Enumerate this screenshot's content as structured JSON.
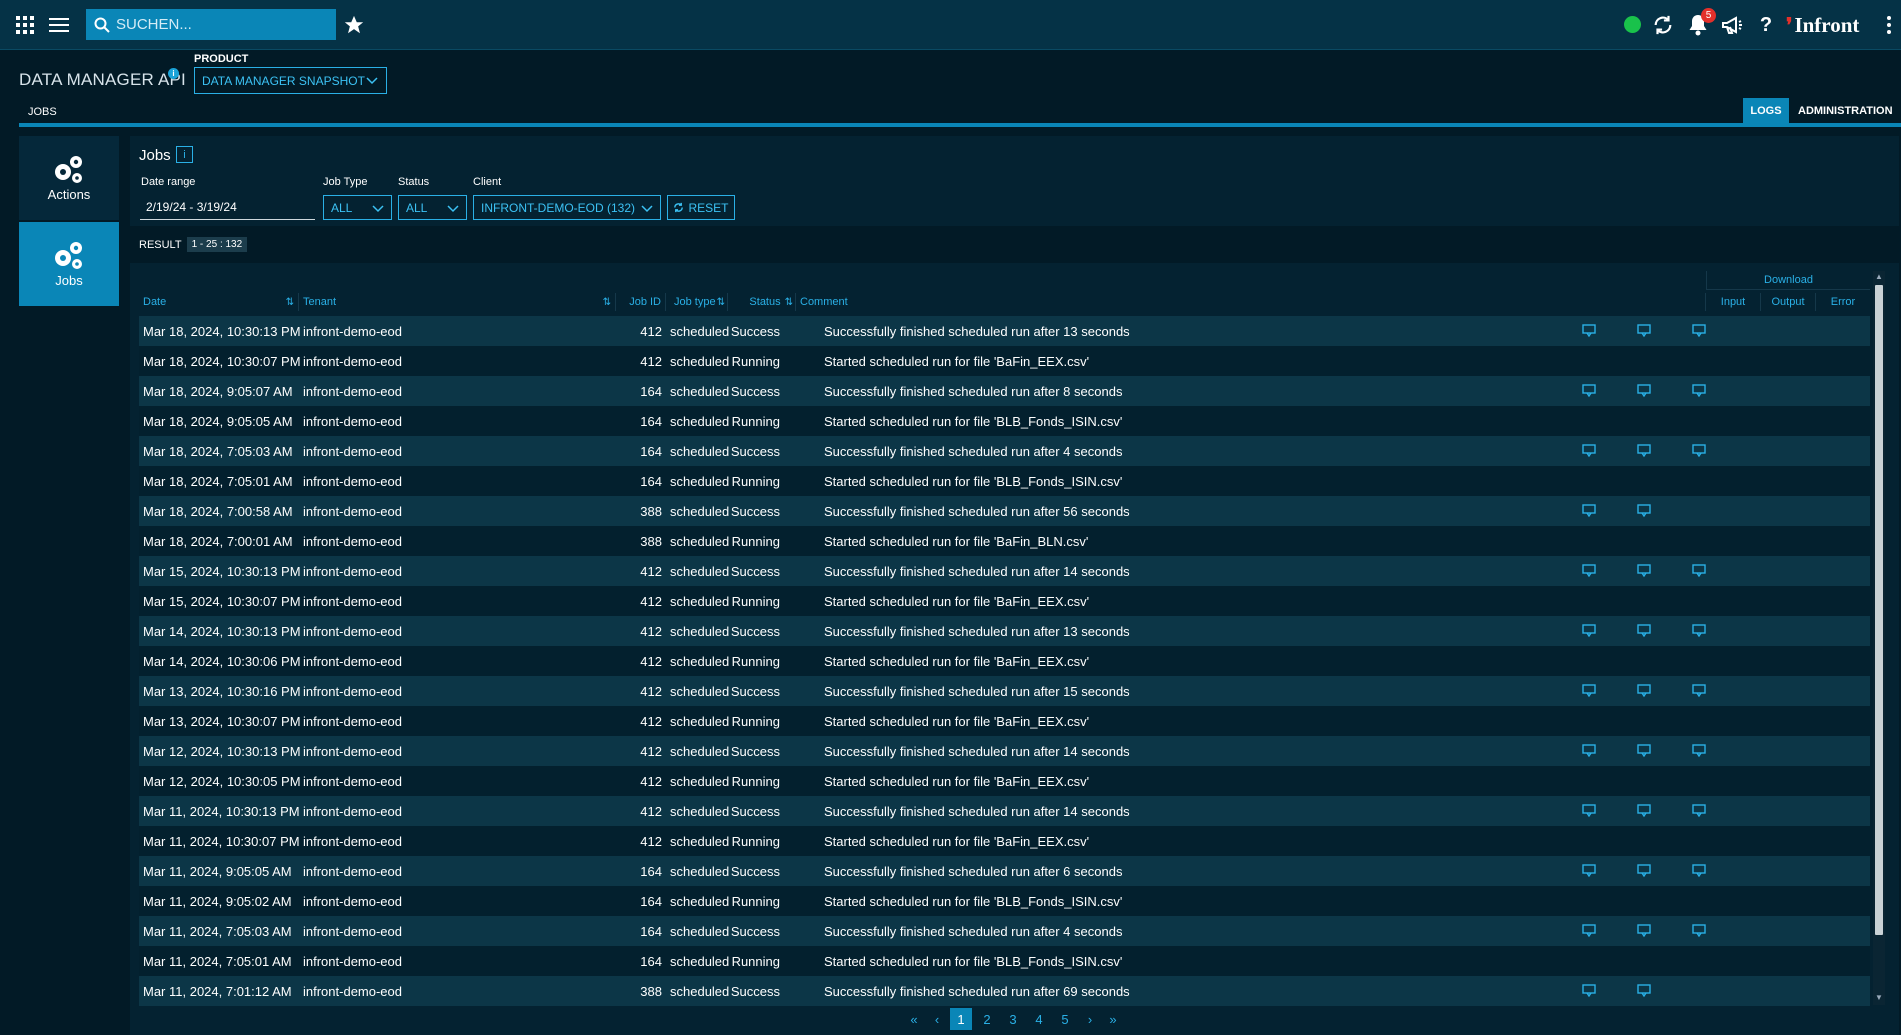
{
  "topbar": {
    "search_placeholder": "SUCHEN...",
    "notification_count": "5",
    "brand": "Infront",
    "status_color": "#19c24b"
  },
  "header": {
    "app_title": "DATA MANAGER API",
    "product_label": "PRODUCT",
    "product_value": "DATA MANAGER SNAPSHOT",
    "tabs": {
      "left": "JOBS",
      "logs": "LOGS",
      "admin": "ADMINISTRATION"
    }
  },
  "nav": [
    {
      "label": "Actions",
      "icon": "gears-icon"
    },
    {
      "label": "Jobs",
      "icon": "gears-icon"
    }
  ],
  "filters": {
    "title": "Jobs",
    "info": "i",
    "date_label": "Date range",
    "date_value": "2/19/24 - 3/19/24",
    "jobtype_label": "Job Type",
    "jobtype_value": "ALL",
    "status_label": "Status",
    "status_value": "ALL",
    "client_label": "Client",
    "client_value": "INFRONT-DEMO-EOD (132)",
    "reset_label": "RESET"
  },
  "result": {
    "label": "RESULT",
    "range": "1 - 25 : 132"
  },
  "table": {
    "download_header": "Download",
    "columns": [
      "Date",
      "Tenant",
      "Job ID",
      "Job type",
      "Status",
      "Comment",
      "Input",
      "Output",
      "Error"
    ],
    "rows": [
      {
        "date": "Mar 18, 2024, 10:30:13 PM",
        "tenant": "infront-demo-eod",
        "id": "412",
        "type": "scheduled",
        "status": "Success",
        "comment": "Successfully finished scheduled run after 13 seconds",
        "dl": [
          1,
          1,
          1
        ]
      },
      {
        "date": "Mar 18, 2024, 10:30:07 PM",
        "tenant": "infront-demo-eod",
        "id": "412",
        "type": "scheduled",
        "status": "Running",
        "comment": "Started scheduled run for file 'BaFin_EEX.csv'",
        "dl": [
          0,
          0,
          0
        ]
      },
      {
        "date": "Mar 18, 2024, 9:05:07 AM",
        "tenant": "infront-demo-eod",
        "id": "164",
        "type": "scheduled",
        "status": "Success",
        "comment": "Successfully finished scheduled run after 8 seconds",
        "dl": [
          1,
          1,
          1
        ]
      },
      {
        "date": "Mar 18, 2024, 9:05:05 AM",
        "tenant": "infront-demo-eod",
        "id": "164",
        "type": "scheduled",
        "status": "Running",
        "comment": "Started scheduled run for file 'BLB_Fonds_ISIN.csv'",
        "dl": [
          0,
          0,
          0
        ]
      },
      {
        "date": "Mar 18, 2024, 7:05:03 AM",
        "tenant": "infront-demo-eod",
        "id": "164",
        "type": "scheduled",
        "status": "Success",
        "comment": "Successfully finished scheduled run after 4 seconds",
        "dl": [
          1,
          1,
          1
        ]
      },
      {
        "date": "Mar 18, 2024, 7:05:01 AM",
        "tenant": "infront-demo-eod",
        "id": "164",
        "type": "scheduled",
        "status": "Running",
        "comment": "Started scheduled run for file 'BLB_Fonds_ISIN.csv'",
        "dl": [
          0,
          0,
          0
        ]
      },
      {
        "date": "Mar 18, 2024, 7:00:58 AM",
        "tenant": "infront-demo-eod",
        "id": "388",
        "type": "scheduled",
        "status": "Success",
        "comment": "Successfully finished scheduled run after 56 seconds",
        "dl": [
          1,
          1,
          0
        ]
      },
      {
        "date": "Mar 18, 2024, 7:00:01 AM",
        "tenant": "infront-demo-eod",
        "id": "388",
        "type": "scheduled",
        "status": "Running",
        "comment": "Started scheduled run for file 'BaFin_BLN.csv'",
        "dl": [
          0,
          0,
          0
        ]
      },
      {
        "date": "Mar 15, 2024, 10:30:13 PM",
        "tenant": "infront-demo-eod",
        "id": "412",
        "type": "scheduled",
        "status": "Success",
        "comment": "Successfully finished scheduled run after 14 seconds",
        "dl": [
          1,
          1,
          1
        ]
      },
      {
        "date": "Mar 15, 2024, 10:30:07 PM",
        "tenant": "infront-demo-eod",
        "id": "412",
        "type": "scheduled",
        "status": "Running",
        "comment": "Started scheduled run for file 'BaFin_EEX.csv'",
        "dl": [
          0,
          0,
          0
        ]
      },
      {
        "date": "Mar 14, 2024, 10:30:13 PM",
        "tenant": "infront-demo-eod",
        "id": "412",
        "type": "scheduled",
        "status": "Success",
        "comment": "Successfully finished scheduled run after 13 seconds",
        "dl": [
          1,
          1,
          1
        ]
      },
      {
        "date": "Mar 14, 2024, 10:30:06 PM",
        "tenant": "infront-demo-eod",
        "id": "412",
        "type": "scheduled",
        "status": "Running",
        "comment": "Started scheduled run for file 'BaFin_EEX.csv'",
        "dl": [
          0,
          0,
          0
        ]
      },
      {
        "date": "Mar 13, 2024, 10:30:16 PM",
        "tenant": "infront-demo-eod",
        "id": "412",
        "type": "scheduled",
        "status": "Success",
        "comment": "Successfully finished scheduled run after 15 seconds",
        "dl": [
          1,
          1,
          1
        ]
      },
      {
        "date": "Mar 13, 2024, 10:30:07 PM",
        "tenant": "infront-demo-eod",
        "id": "412",
        "type": "scheduled",
        "status": "Running",
        "comment": "Started scheduled run for file 'BaFin_EEX.csv'",
        "dl": [
          0,
          0,
          0
        ]
      },
      {
        "date": "Mar 12, 2024, 10:30:13 PM",
        "tenant": "infront-demo-eod",
        "id": "412",
        "type": "scheduled",
        "status": "Success",
        "comment": "Successfully finished scheduled run after 14 seconds",
        "dl": [
          1,
          1,
          1
        ]
      },
      {
        "date": "Mar 12, 2024, 10:30:05 PM",
        "tenant": "infront-demo-eod",
        "id": "412",
        "type": "scheduled",
        "status": "Running",
        "comment": "Started scheduled run for file 'BaFin_EEX.csv'",
        "dl": [
          0,
          0,
          0
        ]
      },
      {
        "date": "Mar 11, 2024, 10:30:13 PM",
        "tenant": "infront-demo-eod",
        "id": "412",
        "type": "scheduled",
        "status": "Success",
        "comment": "Successfully finished scheduled run after 14 seconds",
        "dl": [
          1,
          1,
          1
        ]
      },
      {
        "date": "Mar 11, 2024, 10:30:07 PM",
        "tenant": "infront-demo-eod",
        "id": "412",
        "type": "scheduled",
        "status": "Running",
        "comment": "Started scheduled run for file 'BaFin_EEX.csv'",
        "dl": [
          0,
          0,
          0
        ]
      },
      {
        "date": "Mar 11, 2024, 9:05:05 AM",
        "tenant": "infront-demo-eod",
        "id": "164",
        "type": "scheduled",
        "status": "Success",
        "comment": "Successfully finished scheduled run after 6 seconds",
        "dl": [
          1,
          1,
          1
        ]
      },
      {
        "date": "Mar 11, 2024, 9:05:02 AM",
        "tenant": "infront-demo-eod",
        "id": "164",
        "type": "scheduled",
        "status": "Running",
        "comment": "Started scheduled run for file 'BLB_Fonds_ISIN.csv'",
        "dl": [
          0,
          0,
          0
        ]
      },
      {
        "date": "Mar 11, 2024, 7:05:03 AM",
        "tenant": "infront-demo-eod",
        "id": "164",
        "type": "scheduled",
        "status": "Success",
        "comment": "Successfully finished scheduled run after 4 seconds",
        "dl": [
          1,
          1,
          1
        ]
      },
      {
        "date": "Mar 11, 2024, 7:05:01 AM",
        "tenant": "infront-demo-eod",
        "id": "164",
        "type": "scheduled",
        "status": "Running",
        "comment": "Started scheduled run for file 'BLB_Fonds_ISIN.csv'",
        "dl": [
          0,
          0,
          0
        ]
      },
      {
        "date": "Mar 11, 2024, 7:01:12 AM",
        "tenant": "infront-demo-eod",
        "id": "388",
        "type": "scheduled",
        "status": "Success",
        "comment": "Successfully finished scheduled run after 69 seconds",
        "dl": [
          1,
          1,
          0
        ]
      }
    ]
  },
  "pagination": {
    "first": "«",
    "prev": "‹",
    "pages": [
      "1",
      "2",
      "3",
      "4",
      "5"
    ],
    "current": "1",
    "next": "›",
    "last": "»"
  },
  "colors": {
    "accent": "#0a86b7",
    "link": "#2ab0e6",
    "bg": "#021a26"
  }
}
